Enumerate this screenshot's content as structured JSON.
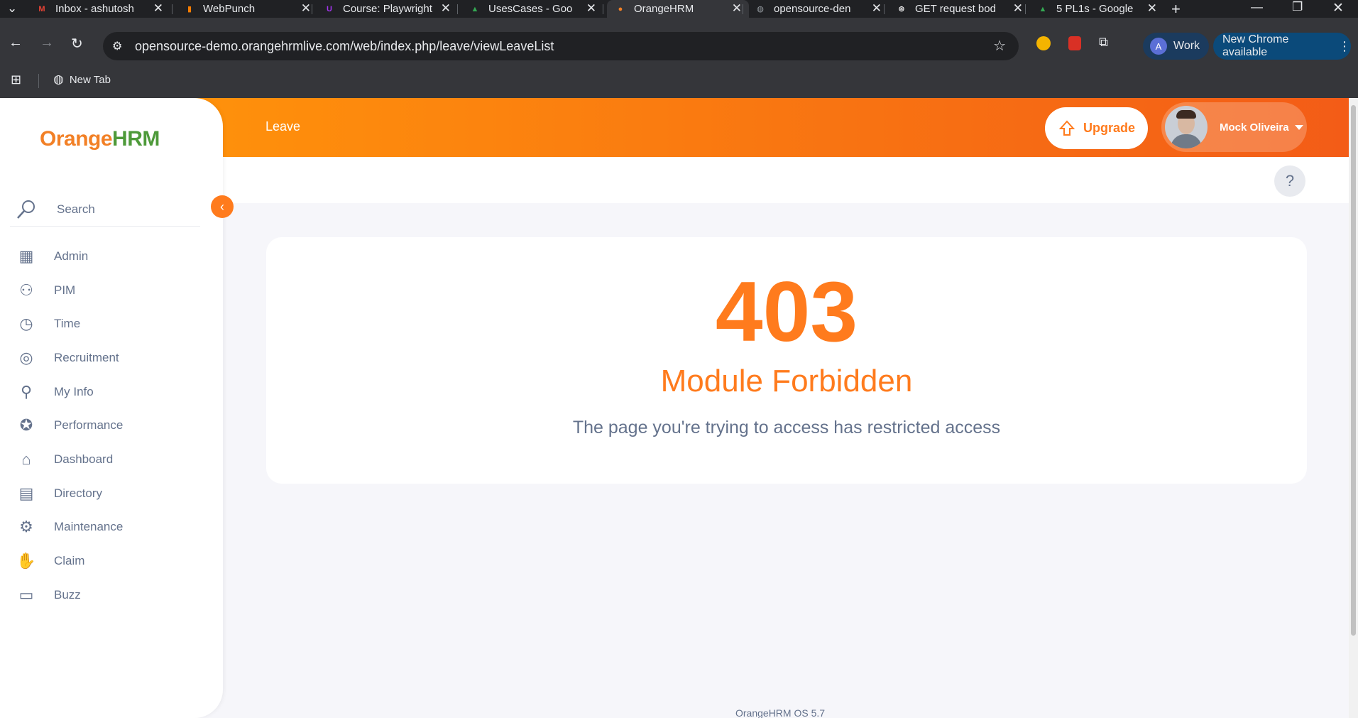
{
  "browser": {
    "tabs": [
      {
        "title": "Inbox - ashutosh",
        "favicon": "gmail-icon",
        "color": "#ea4335",
        "letter": "M"
      },
      {
        "title": "WebPunch",
        "favicon": "webpunch-icon",
        "color": "#f57c00",
        "letter": "▮"
      },
      {
        "title": "Course: Playwright",
        "favicon": "udemy-icon",
        "color": "#a435f0",
        "letter": "U"
      },
      {
        "title": "UsesCases - Goo",
        "favicon": "drive-icon",
        "color": "#34a853",
        "letter": "▲"
      },
      {
        "title": "OrangeHRM",
        "favicon": "orangehrm-icon",
        "color": "#f28026",
        "letter": "●"
      },
      {
        "title": "opensource-den",
        "favicon": "globe-icon",
        "color": "#9aa0a6",
        "letter": "◍"
      },
      {
        "title": "GET request bod",
        "favicon": "openai-icon",
        "color": "#ffffff",
        "letter": "⊛"
      },
      {
        "title": "5 PL1s - Google",
        "favicon": "drive-icon",
        "color": "#34a853",
        "letter": "▲"
      }
    ],
    "active_tab": 4,
    "url": "opensource-demo.orangehrmlive.com/web/index.php/leave/viewLeaveList",
    "profile_label": "Work",
    "profile_initial": "A",
    "update_label": "New Chrome available",
    "bookmark_label": "New Tab"
  },
  "app": {
    "logo_orange": "Orange",
    "logo_hrm": "HRM",
    "header_title": "Leave",
    "upgrade_label": "Upgrade",
    "user_name": "Mock Oliveira",
    "search_placeholder": "Search",
    "help_label": "?",
    "menu": [
      {
        "label": "Admin",
        "icon": "admin-icon"
      },
      {
        "label": "PIM",
        "icon": "pim-icon"
      },
      {
        "label": "Time",
        "icon": "time-icon"
      },
      {
        "label": "Recruitment",
        "icon": "recruitment-icon"
      },
      {
        "label": "My Info",
        "icon": "my-info-icon"
      },
      {
        "label": "Performance",
        "icon": "performance-icon"
      },
      {
        "label": "Dashboard",
        "icon": "dashboard-icon"
      },
      {
        "label": "Directory",
        "icon": "directory-icon"
      },
      {
        "label": "Maintenance",
        "icon": "maintenance-icon"
      },
      {
        "label": "Claim",
        "icon": "claim-icon"
      },
      {
        "label": "Buzz",
        "icon": "buzz-icon"
      }
    ],
    "error_code": "403",
    "error_title": "Module Forbidden",
    "error_message": "The page you're trying to access has restricted access",
    "footer": "OrangeHRM OS 5.7",
    "accent_color": "#ff7b1d",
    "text_color": "#64728c"
  }
}
